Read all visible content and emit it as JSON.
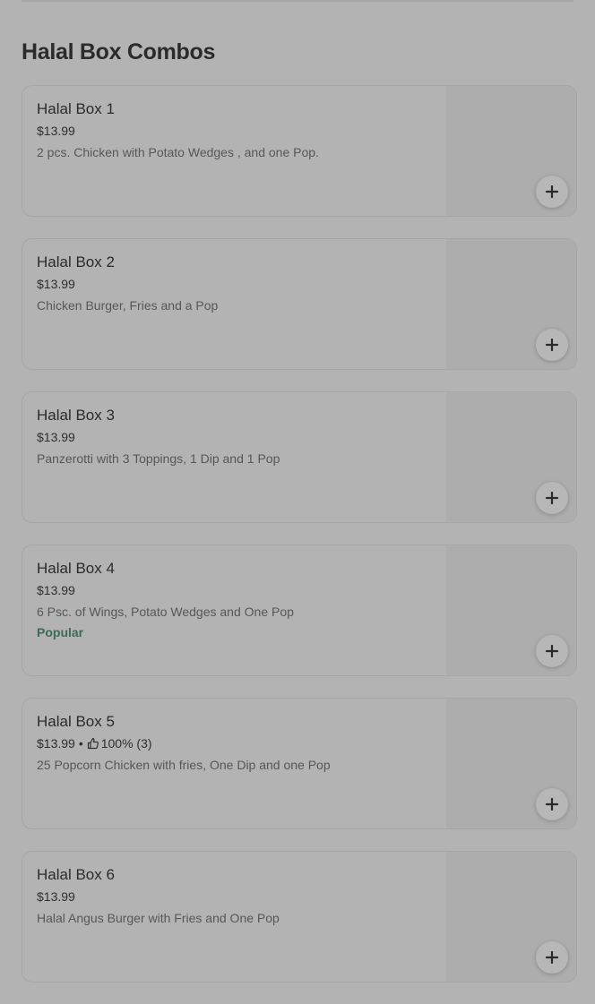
{
  "section": {
    "title": "Halal Box Combos"
  },
  "items": [
    {
      "name": "Halal Box 1",
      "price": "$13.99",
      "description": "2 pcs. Chicken with Potato Wedges , and one Pop."
    },
    {
      "name": "Halal Box 2",
      "price": "$13.99",
      "description": "Chicken Burger, Fries and a Pop"
    },
    {
      "name": "Halal Box 3",
      "price": "$13.99",
      "description": "Panzerotti with 3 Toppings, 1 Dip and 1 Pop"
    },
    {
      "name": "Halal Box 4",
      "price": "$13.99",
      "description": "6 Psc. of Wings, Potato Wedges and One Pop",
      "badge": "Popular"
    },
    {
      "name": "Halal Box 5",
      "price": "$13.99",
      "separator": "•",
      "rating": "100% (3)",
      "description": "25 Popcorn Chicken with fries, One Dip and one Pop"
    },
    {
      "name": "Halal Box 6",
      "price": "$13.99",
      "description": "Halal Angus Burger with Fries and One Pop"
    }
  ],
  "icons": {
    "add": "plus-icon",
    "rating": "thumbs-up-icon"
  },
  "colors": {
    "background": "#b3b3b3",
    "popular_badge": "#3d6b56"
  }
}
